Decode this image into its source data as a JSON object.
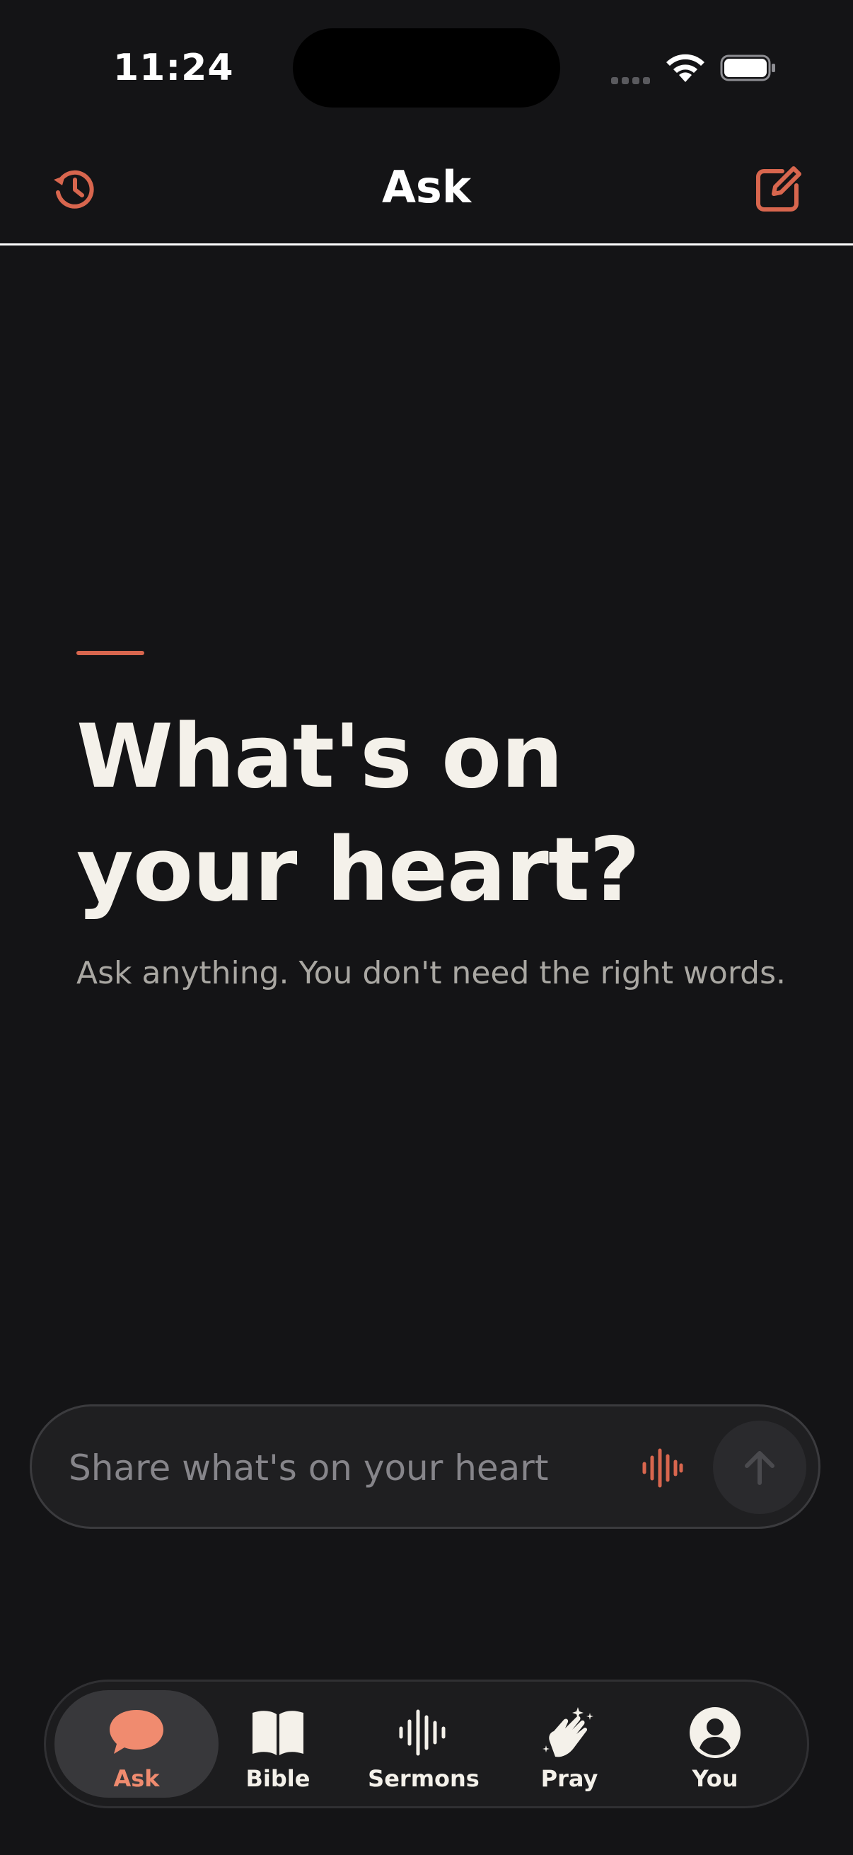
{
  "status_bar": {
    "time": "11:24"
  },
  "header": {
    "title": "Ask"
  },
  "hero": {
    "headline_line1": "What's on",
    "headline_line2": "your heart?",
    "subtitle": "Ask anything. You don't need the right words."
  },
  "composer": {
    "placeholder": "Share what's on your heart"
  },
  "tabs": [
    {
      "label": "Ask",
      "icon": "chat-bubble-icon",
      "active": true
    },
    {
      "label": "Bible",
      "icon": "book-icon",
      "active": false
    },
    {
      "label": "Sermons",
      "icon": "waveform-icon",
      "active": false
    },
    {
      "label": "Pray",
      "icon": "praying-hands-icon",
      "active": false
    },
    {
      "label": "You",
      "icon": "person-icon",
      "active": false
    }
  ],
  "colors": {
    "accent": "#d8664e",
    "active_tab": "#f08b6f",
    "background": "#141416",
    "text": "#f4f1ea"
  }
}
